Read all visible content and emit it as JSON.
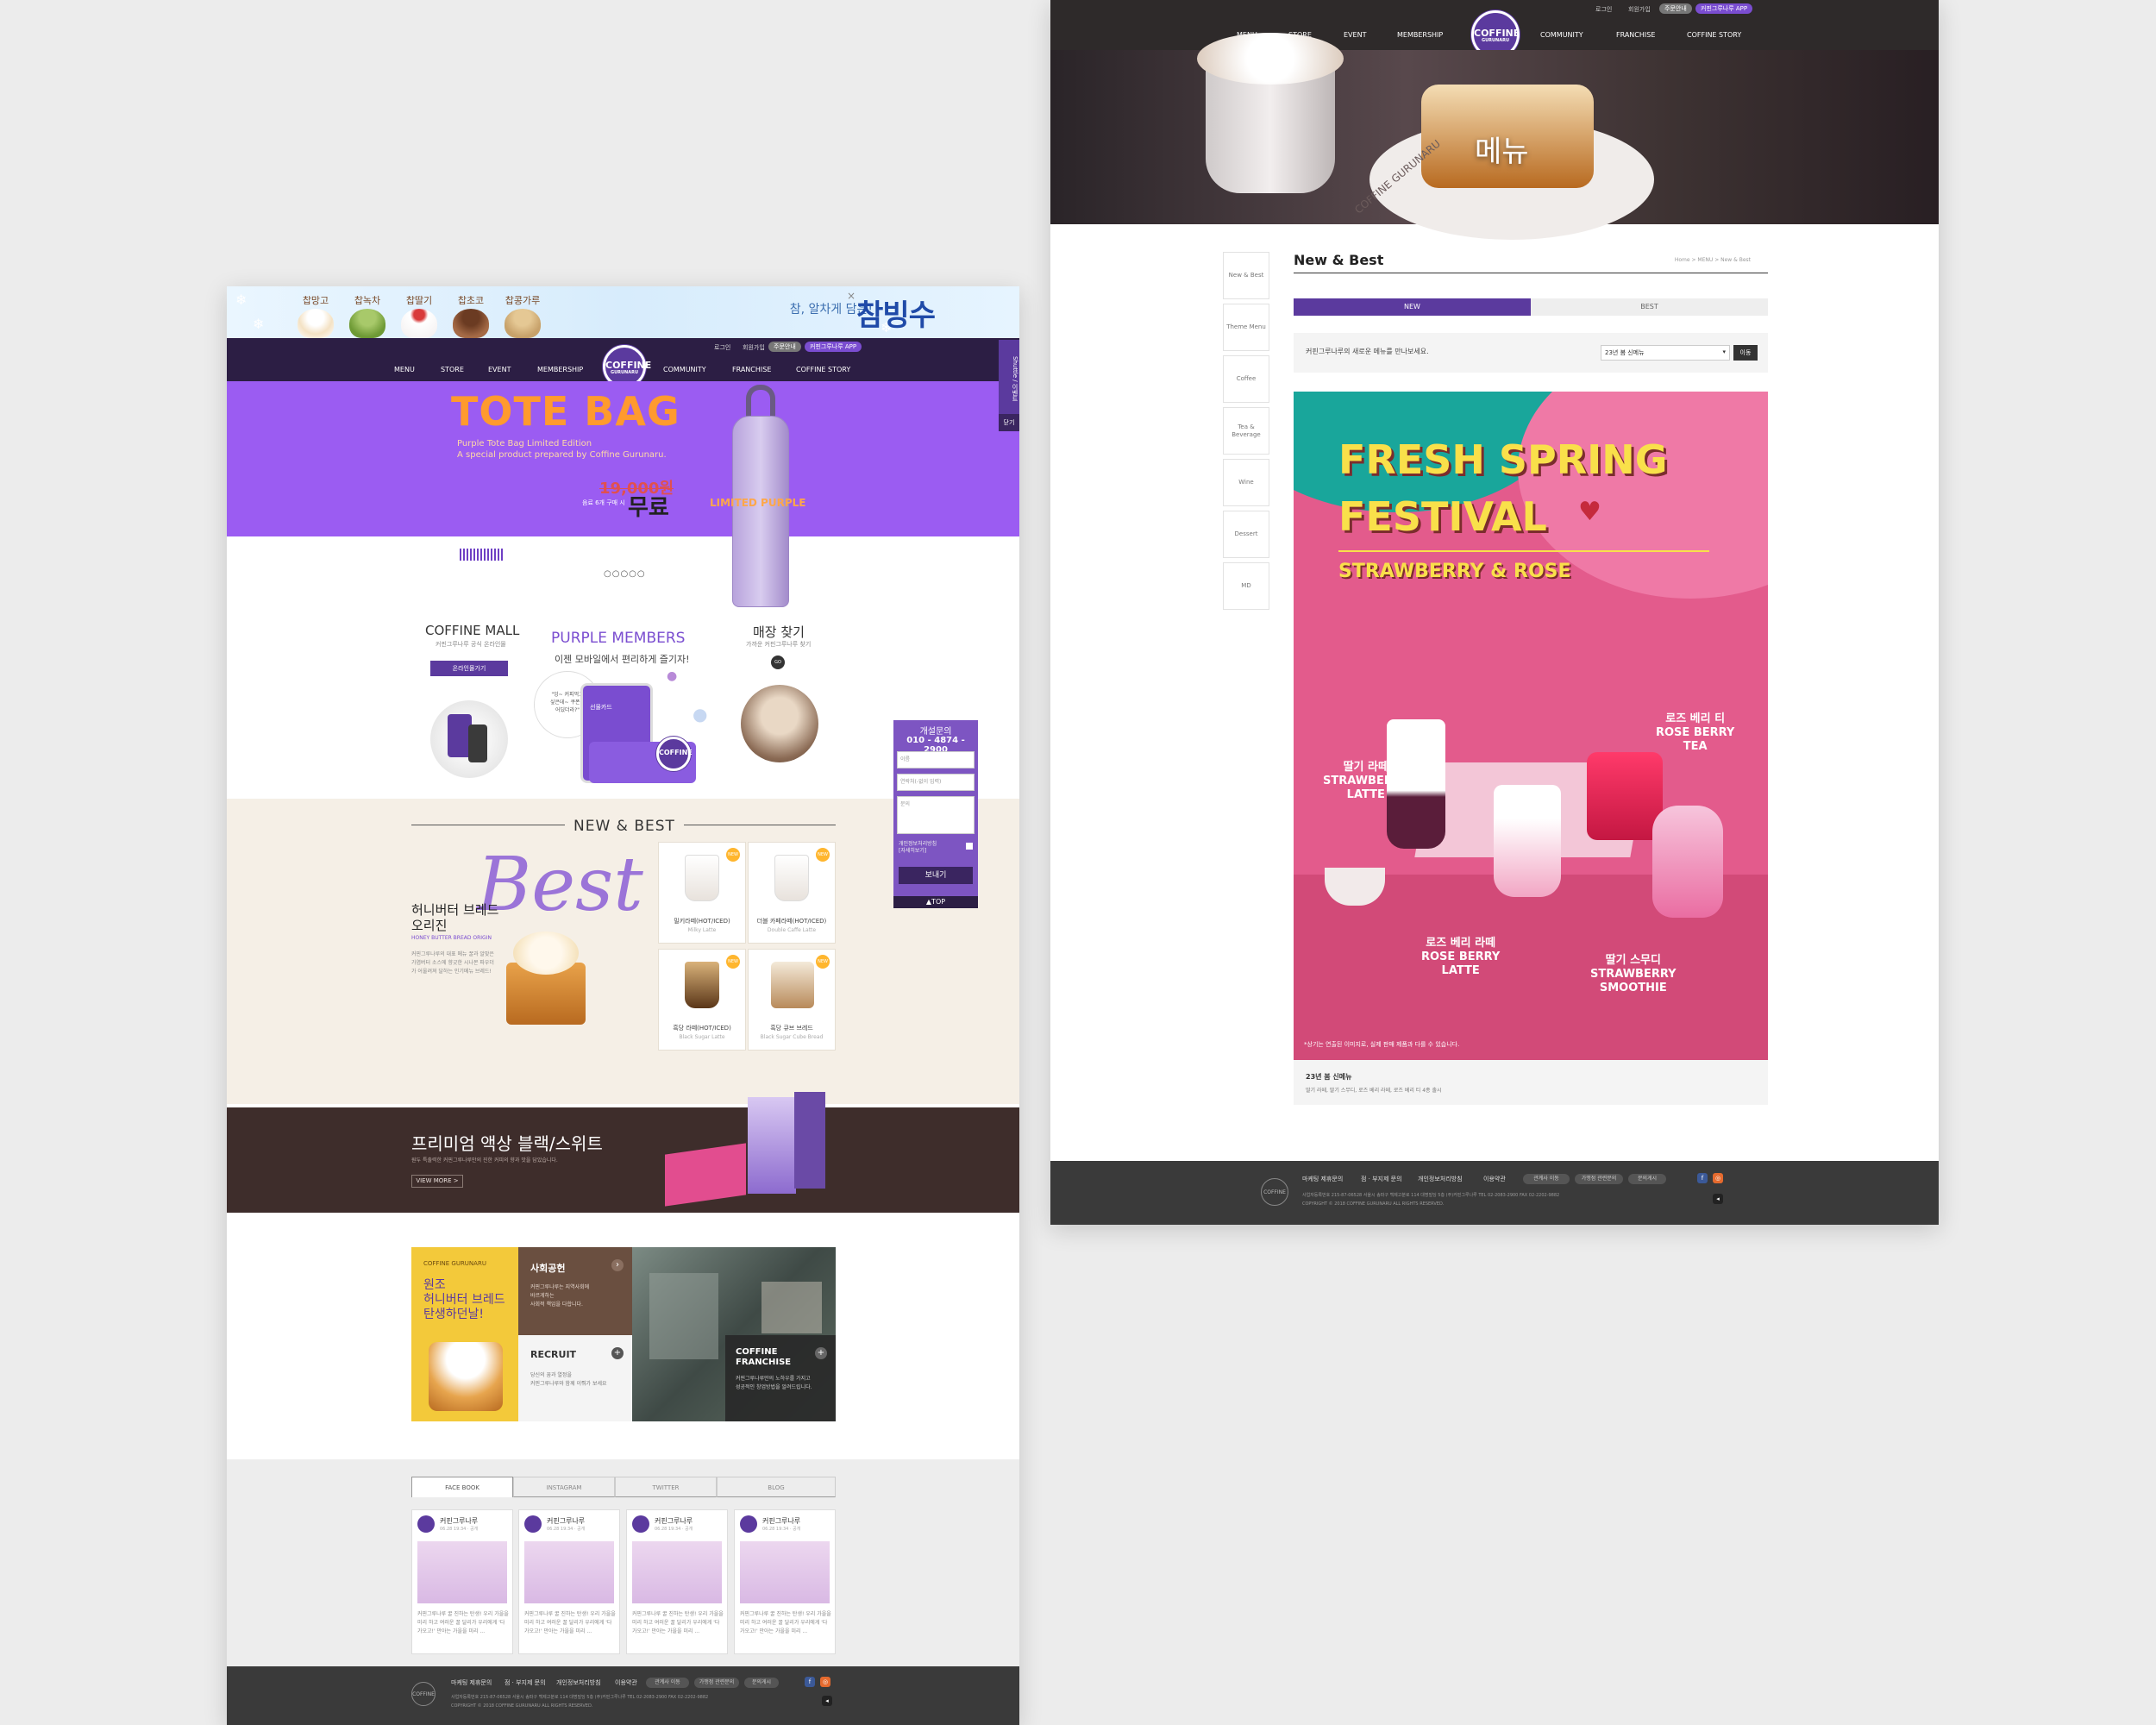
{
  "left": {
    "promo": {
      "flavors": [
        "찹망고",
        "찹녹차",
        "찹딸기",
        "찹초코",
        "찹콩가루"
      ],
      "tagline": "참, 알차게 담은!",
      "title": "참빙수",
      "close": "×"
    },
    "nav": {
      "utils": [
        "로그인",
        "회원가입"
      ],
      "pills": [
        "주문안내",
        "커핀그루나루 APP"
      ],
      "items_left": [
        "MENU",
        "STORE",
        "EVENT",
        "MEMBERSHIP"
      ],
      "items_right": [
        "COMMUNITY",
        "FRANCHISE",
        "COFFINE STORY"
      ],
      "logo_main": "COFFINE",
      "logo_sub": "GURUNARU"
    },
    "hero": {
      "title": "TOTE BAG",
      "sub1": "Purple Tote Bag Limited Edition",
      "sub2": "A special product prepared by Coffine Gurunaru.",
      "old_price": "19,000원",
      "condition": "음료 6개 구매 시",
      "free": "무료",
      "bag_label": "LIMITED PURPLE",
      "dots": "○○○○○",
      "side_tab": "Shuttle / 이벤트",
      "side_tab2": "닫기"
    },
    "cards": {
      "mall_title": "COFFINE MALL",
      "mall_sub": "커핀그루나루 공식 온라인몰",
      "mall_btn": "온라인몰가기",
      "members_title": "PURPLE MEMBERS",
      "members_sub": "이젠 모바일에서 편리하게 즐기자!",
      "members_bubble": "\"잉~ 커피먹고\n싶은데~ 쿠폰이\n어딨더라?\"",
      "members_phone": "선물카드",
      "store_title": "매장 찾기",
      "store_sub": "가까운 커핀그루나루 찾기",
      "store_go": "GO"
    },
    "new_best": {
      "title": "NEW & BEST",
      "script": "Best",
      "name": "허니버터 브레드\n오리진",
      "name_en": "HONEY BUTTER BREAD ORIGIN",
      "desc": "커핀그루나루의 대표 메뉴 꿀과 알맞은 가염버터 소스에 향긋한 시나몬 파우더가 어울려져 달하는 인기메뉴 브레드!",
      "products": [
        {
          "name": "밀키라떼(HOT/ICED)",
          "en": "Milky Latte",
          "tag": "NEW"
        },
        {
          "name": "더블 카페라떼(HOT/ICED)",
          "en": "Double Caffe Latte",
          "tag": "NEW"
        },
        {
          "name": "흑당 라떼(HOT/ICED)",
          "en": "Black Sugar Latte",
          "tag": "NEW"
        },
        {
          "name": "흑당 큐브 브레드",
          "en": "Black Sugar Cube Bread",
          "tag": "NEW"
        }
      ]
    },
    "premium": {
      "title": "프리미엄 액상 블랙/스위트",
      "sub": "원두 특출력한 커핀그루나루만의 진한 커피의 향과 맛을 담았습니다.",
      "btn": "VIEW MORE >"
    },
    "grid": {
      "brand_small": "COFFINE GURUNARU",
      "brand_text": "원조\n허니버터 브레드\n탄생하던날!",
      "social_title": "사회공헌",
      "social_text": "커핀그루나루는 지역사회에\n바르게하는\n사회적 책임을 다합니다.",
      "recruit_title": "RECRUIT",
      "recruit_text": "당신의 꿈과 열정을\n커핀그루나루와 함께 이뤄가 보세요",
      "franchise_title": "COFFINE\nFRANCHISE",
      "franchise_text": "커핀그루나루만의 노하우를 가지고\n성공적인 창업방법을 알려드립니다."
    },
    "social": {
      "tabs": [
        "FACE BOOK",
        "INSTAGRAM",
        "TWITTER",
        "BLOG"
      ],
      "posts": [
        {
          "name": "커핀그루나루",
          "date": "06.28 19:34 · 공개",
          "text": "커핀그루나루 꿀 진하는 탄생! 우리 가을을 미리 하고 여러운 꿀 달리가 우리에게 '다가오고!' 만아는 가을을 미리 ..."
        },
        {
          "name": "커핀그루나루",
          "date": "06.28 19:34 · 공개",
          "text": "커핀그루나루 꿀 진하는 탄생! 우리 가을을 미리 하고 여러운 꿀 달리가 우리에게 '다가오고!' 만아는 가을을 미리 ..."
        },
        {
          "name": "커핀그루나루",
          "date": "06.28 19:34 · 공개",
          "text": "커핀그루나루 꿀 진하는 탄생! 우리 가을을 미리 하고 여러운 꿀 달리가 우리에게 '다가오고!' 만아는 가을을 미리 ..."
        },
        {
          "name": "커핀그루나루",
          "date": "06.28 19:34 · 공개",
          "text": "커핀그루나루 꿀 진하는 탄생! 우리 가을을 미리 하고 여러운 꿀 달리가 우리에게 '다가오고!' 만아는 가을을 미리 ..."
        }
      ]
    },
    "widget": {
      "title": "개설문의",
      "phone": "010 - 4874 - 2900",
      "name_ph": "이름",
      "contact_ph": "연락처(-없이 입력)",
      "msg_ph": "문의",
      "agree": "개인정보처리방침\n[자세히보기]",
      "send": "보내기",
      "top": "▲TOP"
    }
  },
  "footer": {
    "links": [
      "마케팅 제휴문의",
      "점 · 부지제 문의",
      "개인정보처리방침",
      "이용약관"
    ],
    "pills": [
      "관계사 이동",
      "가맹점 관련문의",
      "문의게시"
    ],
    "address": "사업자등록번호 215-87-06528 서울시 송파구 백제고분로 114 대명빌딩 5층 (주)커핀그루나루 TEL 02-2083-2900 FAX 02-2202-9882",
    "copyright": "COPYRIGHT © 2018 COFFINE GURUNARU ALL RIGHTS RESERVED.",
    "logo": "COFFINE"
  },
  "right": {
    "nav": {
      "utils": [
        "로그인",
        "회원가입"
      ],
      "pills": [
        "주문안내",
        "커핀그루나루 APP"
      ],
      "items_left": [
        "MENU",
        "STORE",
        "EVENT",
        "MEMBERSHIP"
      ],
      "items_right": [
        "COMMUNITY",
        "FRANCHISE",
        "COFFINE STORY"
      ],
      "logo_main": "COFFINE",
      "logo_sub": "GURUNARU"
    },
    "hero": {
      "title": "메뉴",
      "cup_brand": "COFFINE GURUNARU"
    },
    "side_nav": [
      "New & Best",
      "Theme Menu",
      "Coffee",
      "Tea & Beverage",
      "Wine",
      "Dessert",
      "MD"
    ],
    "page_title": "New & Best",
    "breadcrumb": "Home > MENU > New & Best",
    "tabs": {
      "new": "NEW",
      "best": "BEST"
    },
    "intro": "커핀그루나루의 새로운 메뉴를 만나보세요.",
    "select_value": "23년 봄 신메뉴",
    "go_btn": "이동",
    "poster": {
      "line1": "FRESH SPRING",
      "line2": "FESTIVAL",
      "sub": "STRAWBERRY & ROSE",
      "items": [
        {
          "ko": "딸기 라떼",
          "en": "STRAWBERRY\nLATTE"
        },
        {
          "ko": "로즈 베리 티",
          "en": "ROSE BERRY\nTEA"
        },
        {
          "ko": "로즈 베리 라떼",
          "en": "ROSE BERRY\nLATTE"
        },
        {
          "ko": "딸기 스무디",
          "en": "STRAWBERRY\nSMOOTHIE"
        }
      ],
      "note": "*상기는 연출된 이미지로, 실제 판매 제품과 다를 수 있습니다."
    },
    "caption_title": "23년 봄 신메뉴",
    "caption_text": "딸기 라떼, 딸기 스무디, 로즈 베리 라떼, 로즈 베리 티 4종 출시"
  },
  "colors": {
    "purple": "#5b3a9e",
    "dark_nav": "#2c1e44",
    "orange": "#ff9a2e",
    "poster_pink": "#e35b8c"
  }
}
